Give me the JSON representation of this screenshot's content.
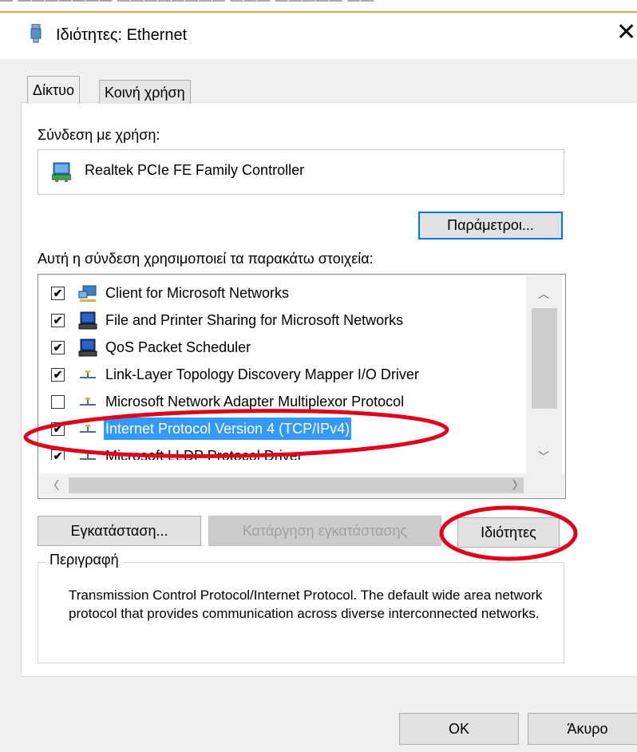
{
  "window": {
    "title": "Ιδιότητες: Ethernet",
    "close_label": "✕"
  },
  "tabs": [
    {
      "label": "Δίκτυο",
      "active": true
    },
    {
      "label": "Κοινή χρήση",
      "active": false
    }
  ],
  "connection": {
    "label": "Σύνδεση με χρήση:",
    "adapter_name": "Realtek PCIe FE Family Controller",
    "configure_button": "Παράμετροι..."
  },
  "items_section": {
    "label": "Αυτή η σύνδεση χρησιμοποιεί τα παρακάτω στοιχεία:",
    "items": [
      {
        "label": "Client for Microsoft Networks",
        "checked": true,
        "icon": "network-client-icon"
      },
      {
        "label": "File and Printer Sharing for Microsoft Networks",
        "checked": true,
        "icon": "computer-icon"
      },
      {
        "label": "QoS Packet Scheduler",
        "checked": true,
        "icon": "computer-icon"
      },
      {
        "label": "Link-Layer Topology Discovery Mapper I/O Driver",
        "checked": true,
        "icon": "protocol-icon"
      },
      {
        "label": "Microsoft Network Adapter Multiplexor Protocol",
        "checked": false,
        "icon": "protocol-icon"
      },
      {
        "label": "Internet Protocol Version 4 (TCP/IPv4)",
        "checked": true,
        "selected": true,
        "icon": "protocol-icon"
      },
      {
        "label": "Microsoft LLDP Protocol Driver",
        "checked": true,
        "icon": "protocol-icon"
      }
    ]
  },
  "buttons": {
    "install": "Εγκατάσταση...",
    "uninstall": "Κατάργηση εγκατάστασης",
    "properties": "Ιδιότητες"
  },
  "description": {
    "legend": "Περιγραφή",
    "text": "Transmission Control Protocol/Internet Protocol. The default wide area network protocol that provides communication across diverse interconnected networks."
  },
  "footer": {
    "ok": "OK",
    "cancel": "Άκυρο"
  },
  "colors": {
    "selection": "#3399ff",
    "annotation": "#e0001b",
    "focus_border": "#0078d7"
  }
}
